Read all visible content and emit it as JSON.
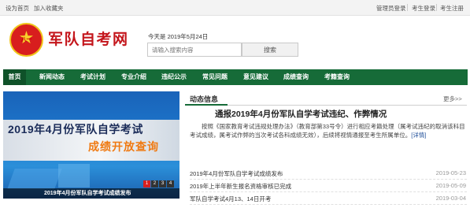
{
  "topbar": {
    "home": "设为首页",
    "favorite": "加入收藏夹",
    "admin_login": "管理员登录",
    "student_login": "考生登录",
    "student_register": "考生注册"
  },
  "header": {
    "logo_text": "八一",
    "logo_icon": "star-icon",
    "site_name": "军队自考网",
    "today": "今天是  2019年5月24日",
    "search_placeholder": "请输入搜索内容",
    "search_button": "搜索"
  },
  "nav": {
    "items": [
      "首页",
      "新闻动态",
      "考试计划",
      "专业介绍",
      "违纪公示",
      "常见问题",
      "意见建议",
      "成绩查询",
      "考籍查询"
    ],
    "active_index": 0
  },
  "banner": {
    "headline": "2019年4月份军队自学考试",
    "subline": "成绩开放查询",
    "caption": "2019年4月份军队自学考试成绩发布",
    "pager": [
      "1",
      "2",
      "3",
      "4"
    ],
    "active_page": 0
  },
  "news": {
    "section_title": "动态信息",
    "more": "更多>>",
    "headline": "通报2019年4月份军队自学考试违纪、作弊情况",
    "summary": "按照《国家教育考试违规处理办法》（教育部第33号令）进行相应考籍处理（属考试违纪的取消该科目考试成绩，属考试作弊的当次考试各科成绩无效），后续将视情通报至考生所属单位。",
    "detail_link": "[详情]",
    "items": [
      {
        "title": "2019年4月份军队自学考试成绩发布",
        "date": "2019-05-23"
      },
      {
        "title": "2019年上半年新生报名资格审核已完成",
        "date": "2019-05-09"
      },
      {
        "title": "军队自学考试4月13、14日开考",
        "date": "2019-03-04"
      }
    ]
  },
  "colors": {
    "nav_green": "#166b38",
    "brand_red": "#c4161c",
    "banner_blue": "#1c74c9",
    "banner_orange": "#f07a12"
  }
}
